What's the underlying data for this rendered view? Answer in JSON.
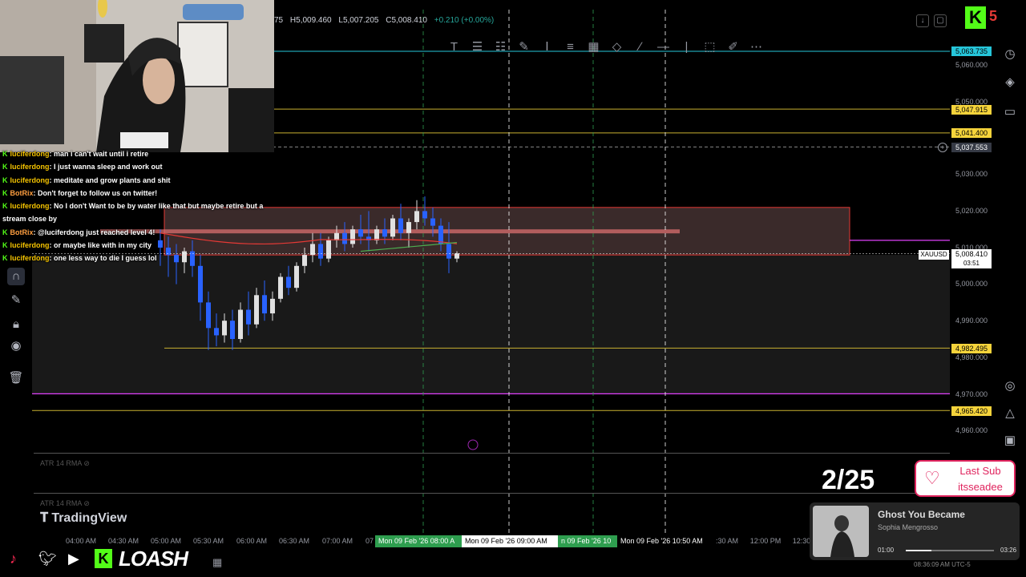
{
  "ohlc": {
    "high": "H5,009.460",
    "low": "L5,007.205",
    "close": "C5,008.410",
    "change": "+0.210 (+0.00%)",
    "open_frag": "75"
  },
  "drawing_toolbar": {
    "icons": [
      "text-icon",
      "align-icon",
      "align-alt-icon",
      "brush-icon",
      "text-cursor-icon",
      "list-icon",
      "grid-icon",
      "diamond-icon",
      "line-icon",
      "horizontal-line-icon",
      "vertical-line-icon",
      "frame-icon",
      "paint-icon",
      "more-icon"
    ]
  },
  "price_axis": {
    "ticks": [
      "5,060.000",
      "5,050.000",
      "5,030.000",
      "5,020.000",
      "5,010.000",
      "5,000.000",
      "4,990.000",
      "4,980.000",
      "4,970.000",
      "4,960.000"
    ],
    "labels": {
      "level_top": "5,063.735",
      "level_1": "5,047.915",
      "level_2": "5,041.400",
      "crosshair": "5,037.553",
      "symbol": "XAUUSD",
      "current": "5,008.410",
      "countdown": "03:51",
      "level_3": "4,982.495",
      "level_4": "4,965.420"
    },
    "colors": {
      "cyan": "#26c6da",
      "yellow": "#f5d33b",
      "current": "#ffffff"
    }
  },
  "time_axis": {
    "labels": [
      "04:00 AM",
      "04:30 AM",
      "05:00 AM",
      "05:30 AM",
      "06:00 AM",
      "06:30 AM",
      "07:00 AM",
      "07",
      ":30 AM",
      "12:00 PM",
      "12:30"
    ],
    "selection": {
      "start": "Mon 09 Feb '26   08:00 A",
      "cursor": "Mon 09 Feb '26   09:00 AM",
      "mid": "n 09 Feb '26   10",
      "end": "Mon 09 Feb '26   10:50 AM"
    }
  },
  "atr": {
    "label_1": "ATR 14 RMA",
    "label_2": "ATR 14 RMA"
  },
  "brand": {
    "tradingview": "TradingView",
    "kick_logo": "K",
    "streamer": "LOASH",
    "kick_count": "5"
  },
  "chat": [
    {
      "user": "luciferdong",
      "bot": false,
      "msg": ": man i can't wait until i retire"
    },
    {
      "user": "luciferdong",
      "bot": false,
      "msg": ": I just wanna sleep and work out"
    },
    {
      "user": "luciferdong",
      "bot": false,
      "msg": ": meditate and grow plants and shit"
    },
    {
      "user": "BotRix",
      "bot": true,
      "msg": ": Don't forget to follow us on twitter!"
    },
    {
      "user": "luciferdong",
      "bot": false,
      "msg": ": No I don't Want to be by water like that but maybe retire but a"
    },
    {
      "user": "",
      "bot": false,
      "msg": "stream close by"
    },
    {
      "user": "BotRix",
      "bot": true,
      "msg": ": @luciferdong just reached level 4!"
    },
    {
      "user": "luciferdong",
      "bot": false,
      "msg": ": or maybe like with in my city"
    },
    {
      "user": "luciferdong",
      "bot": false,
      "msg": ": one less way to die I guess lol"
    }
  ],
  "subs": {
    "count": "2/25",
    "last_sub_label": "Last Sub",
    "last_sub_user": "itsseadee"
  },
  "now_playing": {
    "title": "Ghost You Became",
    "artist": "Sophia Mengrosso",
    "elapsed": "01:00",
    "duration": "03:26",
    "progress": 0.29,
    "clock": "08:36:09 AM UTC-5"
  },
  "chart_data": {
    "type": "candlestick",
    "ylim": [
      4955,
      5065
    ],
    "levels": [
      5063.735,
      5047.915,
      5041.4,
      4982.495,
      4965.42
    ],
    "current": 5008.41,
    "candles": [
      {
        "o": 5012,
        "h": 5015,
        "c": 5010,
        "l": 5005,
        "up": false
      },
      {
        "o": 5010,
        "h": 5013,
        "c": 5008,
        "l": 5002,
        "up": false
      },
      {
        "o": 5008,
        "h": 5011,
        "c": 5006,
        "l": 5000,
        "up": false
      },
      {
        "o": 5006,
        "h": 5010,
        "c": 5009,
        "l": 5003,
        "up": true
      },
      {
        "o": 5009,
        "h": 5012,
        "c": 5005,
        "l": 5002,
        "up": false
      },
      {
        "o": 5005,
        "h": 5008,
        "c": 4995,
        "l": 4990,
        "up": false
      },
      {
        "o": 4995,
        "h": 4998,
        "c": 4988,
        "l": 4982,
        "up": false
      },
      {
        "o": 4988,
        "h": 4992,
        "c": 4986,
        "l": 4983,
        "up": false
      },
      {
        "o": 4986,
        "h": 4992,
        "c": 4990,
        "l": 4984,
        "up": true
      },
      {
        "o": 4990,
        "h": 4993,
        "c": 4985,
        "l": 4982,
        "up": false
      },
      {
        "o": 4985,
        "h": 4995,
        "c": 4993,
        "l": 4984,
        "up": true
      },
      {
        "o": 4993,
        "h": 4998,
        "c": 4989,
        "l": 4986,
        "up": false
      },
      {
        "o": 4989,
        "h": 4999,
        "c": 4997,
        "l": 4988,
        "up": true
      },
      {
        "o": 4997,
        "h": 5001,
        "c": 4992,
        "l": 4990,
        "up": false
      },
      {
        "o": 4992,
        "h": 4998,
        "c": 4996,
        "l": 4990,
        "up": true
      },
      {
        "o": 4996,
        "h": 5003,
        "c": 5002,
        "l": 4995,
        "up": true
      },
      {
        "o": 5002,
        "h": 5005,
        "c": 4999,
        "l": 4997,
        "up": false
      },
      {
        "o": 4999,
        "h": 5006,
        "c": 5005,
        "l": 4998,
        "up": true
      },
      {
        "o": 5005,
        "h": 5010,
        "c": 5008,
        "l": 5003,
        "up": true
      },
      {
        "o": 5008,
        "h": 5014,
        "c": 5011,
        "l": 5006,
        "up": true
      },
      {
        "o": 5011,
        "h": 5014,
        "c": 5007,
        "l": 5005,
        "up": false
      },
      {
        "o": 5007,
        "h": 5013,
        "c": 5012,
        "l": 5006,
        "up": true
      },
      {
        "o": 5012,
        "h": 5016,
        "c": 5014,
        "l": 5010,
        "up": true
      },
      {
        "o": 5014,
        "h": 5017,
        "c": 5011,
        "l": 5009,
        "up": false
      },
      {
        "o": 5011,
        "h": 5016,
        "c": 5015,
        "l": 5010,
        "up": true
      },
      {
        "o": 5015,
        "h": 5019,
        "c": 5013,
        "l": 5011,
        "up": false
      },
      {
        "o": 5013,
        "h": 5020,
        "c": 5012,
        "l": 5009,
        "up": false
      },
      {
        "o": 5012,
        "h": 5016,
        "c": 5015,
        "l": 5011,
        "up": true
      },
      {
        "o": 5015,
        "h": 5018,
        "c": 5013,
        "l": 5011,
        "up": false
      },
      {
        "o": 5013,
        "h": 5019,
        "c": 5018,
        "l": 5012,
        "up": true
      },
      {
        "o": 5018,
        "h": 5022,
        "c": 5014,
        "l": 5012,
        "up": false
      },
      {
        "o": 5014,
        "h": 5018,
        "c": 5017,
        "l": 5010,
        "up": true
      },
      {
        "o": 5017,
        "h": 5023,
        "c": 5020,
        "l": 5015,
        "up": true
      },
      {
        "o": 5020,
        "h": 5024,
        "c": 5018,
        "l": 5016,
        "up": false
      },
      {
        "o": 5018,
        "h": 5021,
        "c": 5016,
        "l": 5013,
        "up": false
      },
      {
        "o": 5016,
        "h": 5018,
        "c": 5011,
        "l": 5009,
        "up": false
      },
      {
        "o": 5011,
        "h": 5017,
        "c": 5007,
        "l": 5003,
        "up": false
      },
      {
        "o": 5007,
        "h": 5009,
        "c": 5008.41,
        "l": 5006,
        "up": true
      }
    ]
  }
}
